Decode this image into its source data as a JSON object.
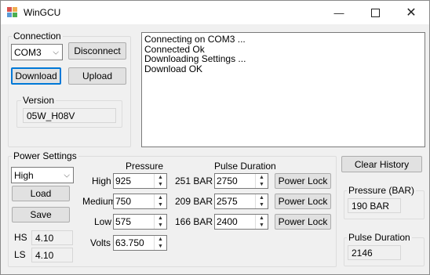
{
  "window": {
    "title": "WinGCU",
    "minimize_icon": "minimize-icon",
    "maximize_icon": "maximize-icon",
    "close_icon": "close-icon"
  },
  "connection": {
    "title": "Connection",
    "port_selected": "COM3",
    "disconnect_label": "Disconnect",
    "download_label": "Download",
    "upload_label": "Upload",
    "version": {
      "title": "Version",
      "value": "05W_H08V"
    }
  },
  "log": {
    "lines": [
      "Connecting on COM3 ...",
      "Connected Ok",
      "Downloading Settings ...",
      "Download OK"
    ]
  },
  "power_settings": {
    "title": "Power Settings",
    "mode_selected": "High",
    "load_label": "Load",
    "save_label": "Save",
    "hs_label": "HS",
    "hs_value": "4.10",
    "ls_label": "LS",
    "ls_value": "4.10",
    "pressure_header": "Pressure",
    "pulse_header": "Pulse Duration",
    "rows": [
      {
        "label": "High",
        "pressure": "925",
        "bar": "251 BAR",
        "pulse": "2750",
        "lock_label": "Power Lock"
      },
      {
        "label": "Medium",
        "pressure": "750",
        "bar": "209 BAR",
        "pulse": "2575",
        "lock_label": "Power Lock"
      },
      {
        "label": "Low",
        "pressure": "575",
        "bar": "166 BAR",
        "pulse": "2400",
        "lock_label": "Power Lock"
      }
    ],
    "volts_label": "Volts",
    "volts_value": "63.750"
  },
  "clear_history_label": "Clear History",
  "pressure_bar": {
    "title": "Pressure (BAR)",
    "value": "190 BAR"
  },
  "pulse_duration": {
    "title": "Pulse Duration",
    "value": "2146"
  }
}
